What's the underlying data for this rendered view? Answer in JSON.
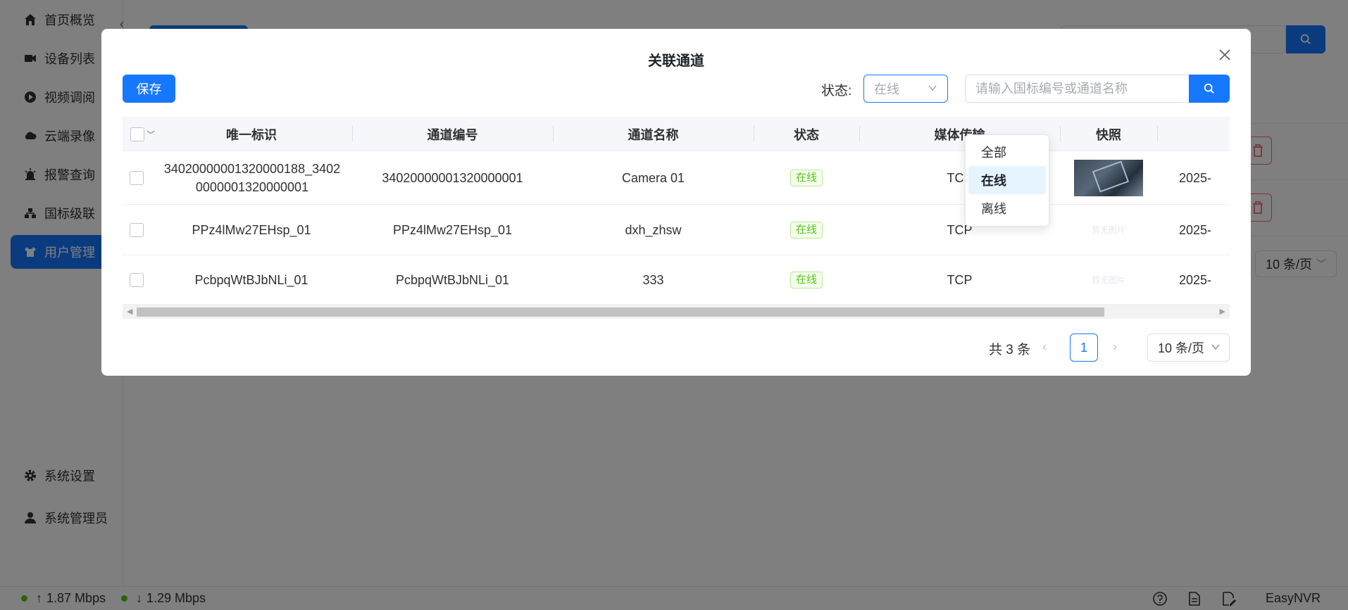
{
  "sidebar": {
    "items": [
      {
        "label": "首页概览",
        "icon": "home-icon"
      },
      {
        "label": "设备列表",
        "icon": "camera-icon"
      },
      {
        "label": "视频调阅",
        "icon": "play-icon"
      },
      {
        "label": "云端录像",
        "icon": "cloud-icon"
      },
      {
        "label": "报警查询",
        "icon": "alarm-icon"
      },
      {
        "label": "国标级联",
        "icon": "cascade-icon"
      },
      {
        "label": "用户管理",
        "icon": "user-shirt-icon"
      }
    ],
    "bottom": [
      {
        "label": "系统设置",
        "icon": "gear-icon"
      },
      {
        "label": "系统管理员",
        "icon": "person-icon"
      }
    ]
  },
  "main": {
    "page_size": "10 条/页"
  },
  "statusbar": {
    "upload": "1.87 Mbps",
    "download": "1.29 Mbps",
    "brand": "EasyNVR"
  },
  "dialog": {
    "title": "关联通道",
    "save_label": "保存",
    "status_label": "状态:",
    "status_value": "在线",
    "search_placeholder": "请输入国标编号或通道名称",
    "columns": [
      "唯一标识",
      "通道编号",
      "通道名称",
      "状态",
      "媒体传输",
      "快照"
    ],
    "rows": [
      {
        "uid": "34020000001320000188_34020000001320000001",
        "code": "34020000001320000001",
        "name": "Camera 01",
        "status": "在线",
        "transport": "TCP",
        "snapshot": "image",
        "time": "2025-"
      },
      {
        "uid": "PPz4lMw27EHsp_01",
        "code": "PPz4lMw27EHsp_01",
        "name": "dxh_zhsw",
        "status": "在线",
        "transport": "TCP",
        "snapshot": "暂无图片",
        "time": "2025-"
      },
      {
        "uid": "PcbpqWtBJbNLi_01",
        "code": "PcbpqWtBJbNLi_01",
        "name": "333",
        "status": "在线",
        "transport": "TCP",
        "snapshot": "暂无图片",
        "time": "2025-"
      }
    ],
    "pagination": {
      "total": "共 3 条",
      "current": "1",
      "page_size": "10 条/页"
    },
    "status_options": [
      "全部",
      "在线",
      "离线"
    ],
    "status_selected_index": 1
  },
  "colors": {
    "primary": "#1677ff",
    "online_green": "#52c41a",
    "danger": "#f56c6c"
  }
}
